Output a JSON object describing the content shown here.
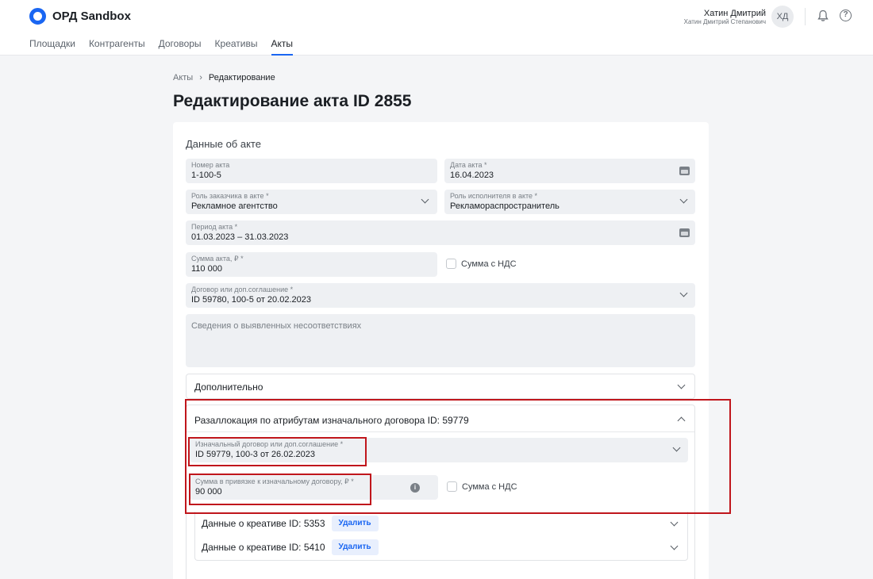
{
  "app": {
    "name": "ОРД Sandbox"
  },
  "nav": {
    "items": [
      {
        "label": "Площадки"
      },
      {
        "label": "Контрагенты"
      },
      {
        "label": "Договоры"
      },
      {
        "label": "Креативы"
      },
      {
        "label": "Акты",
        "active": true
      }
    ]
  },
  "user": {
    "short_name": "Хатин Дмитрий",
    "full_name": "Хатин Дмитрий Степанович",
    "initials": "ХД"
  },
  "breadcrumb": {
    "parent": "Акты",
    "current": "Редактирование"
  },
  "page": {
    "title": "Редактирование акта ID 2855"
  },
  "act": {
    "section_title": "Данные об акте",
    "number": {
      "label": "Номер акта",
      "value": "1-100-5"
    },
    "date": {
      "label": "Дата акта *",
      "value": "16.04.2023"
    },
    "client_role": {
      "label": "Роль заказчика в акте *",
      "value": "Рекламное агентство"
    },
    "contractor_role": {
      "label": "Роль исполнителя в акте *",
      "value": "Рекламораспространитель"
    },
    "period": {
      "label": "Период акта *",
      "value": "01.03.2023 – 31.03.2023"
    },
    "amount": {
      "label": "Сумма акта, ₽ *",
      "value": "110 000"
    },
    "vat_checkbox": {
      "label": "Сумма с НДС",
      "checked": false
    },
    "contract": {
      "label": "Договор или доп.соглашение *",
      "value": "ID 59780, 100-5 от 20.02.2023"
    },
    "discrepancies": {
      "placeholder": "Сведения о выявленных несоответствиях"
    }
  },
  "additional": {
    "title": "Дополнительно"
  },
  "reallocation": {
    "title": "Разаллокация по атрибутам изначального договора ID: 59779",
    "contract": {
      "label": "Изначальный договор или доп.соглашение *",
      "value": "ID 59779, 100-3 от 26.02.2023"
    },
    "amount": {
      "label": "Сумма в привязке к изначальному договору, ₽ *",
      "value": "90 000"
    },
    "vat_checkbox": {
      "label": "Сумма с НДС",
      "checked": false
    },
    "creatives": [
      {
        "title": "Данные о креативе ID: 5353",
        "delete_label": "Удалить"
      },
      {
        "title": "Данные о креативе ID: 5410",
        "delete_label": "Удалить"
      }
    ]
  },
  "colors": {
    "accent": "#1a66f2",
    "highlight": "#c0161c",
    "field_bg": "#eef0f3"
  }
}
